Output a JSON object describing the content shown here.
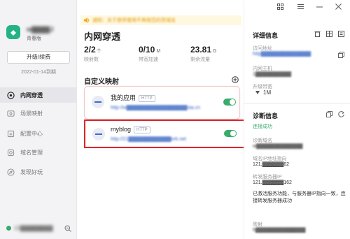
{
  "window": {
    "grid_icon": "grid-icon",
    "menu_icon": "menu-icon",
    "minimize_icon": "minimize-icon",
    "close_icon": "close-icon"
  },
  "sidebar": {
    "user_name": "w▓▓▓▓J",
    "edition": "青春版",
    "upgrade_button": "升级/续费",
    "expiry": "2022-01-14到期",
    "items": [
      {
        "label": "内网穿透",
        "icon": "penetration-icon",
        "active": true
      },
      {
        "label": "场景映射",
        "icon": "scene-icon"
      },
      {
        "label": "配置中心",
        "icon": "config-icon"
      },
      {
        "label": "域名管理",
        "icon": "domain-icon"
      },
      {
        "label": "发现好玩",
        "icon": "discover-icon"
      }
    ],
    "status_ip": "10▓▓▓▓▓▓▓▓"
  },
  "notice": {
    "text": "通知：关于禁停使用不再规范的亮域名"
  },
  "main": {
    "title": "内网穿透",
    "stats": [
      {
        "value": "2/2",
        "unit": "个",
        "label": "映射数"
      },
      {
        "value": "0/10",
        "unit": "M",
        "label": "带宽加速"
      },
      {
        "value": "23.81",
        "unit": "G",
        "label": "剩余流量"
      }
    ],
    "section_title": "自定义映射",
    "mappings": [
      {
        "name": "我的应用",
        "protocol": "HTTP",
        "url": "http://w▓▓▓▓▓▓▓▓▓▓▓▓▓▓▓▓▓sta.cn",
        "enabled": true
      },
      {
        "name": "myblog",
        "protocol": "HTTP",
        "url": "http://21▓▓▓▓▓▓▓▓▓▓▓▓ork.net",
        "enabled": true
      }
    ]
  },
  "detail": {
    "title": "详细信息",
    "visit_label": "访问地址",
    "visit_value": "http▓▓▓▓▓▓▓▓▓▓▓▓▓▓",
    "host_label": "内网主机",
    "host_value": "1▓▓▓▓▓▓▓▓▓▓",
    "bandwidth_label": "升级带宽",
    "bandwidth_value": "1M"
  },
  "diagnosis": {
    "title": "诊断信息",
    "status": "连接成功",
    "domain_label": "诊断域名",
    "domain_value": "w▓▓▓▓▓▓▓▓▓▓▓▓▓",
    "ip_label": "域名IP地址指向",
    "ip_value": "121.▓▓▓▓▓▓62",
    "forward_label": "转发服务器IP",
    "forward_value": "121.▓▓▓▓▓▓162",
    "message": "已激活服务功能，与服务器IP指向一致，连接转发服务器成功",
    "map_label": "映射",
    "map_value": "h▓▓▓▓▓▓▓▓▓▓▓▓▓▓"
  },
  "colors": {
    "accent": "#3aab6b",
    "link": "#2f5fc0",
    "highlight_box": "#d9262b",
    "notice_bg": "#fff8e1",
    "error_border": "#f3c6c6"
  }
}
